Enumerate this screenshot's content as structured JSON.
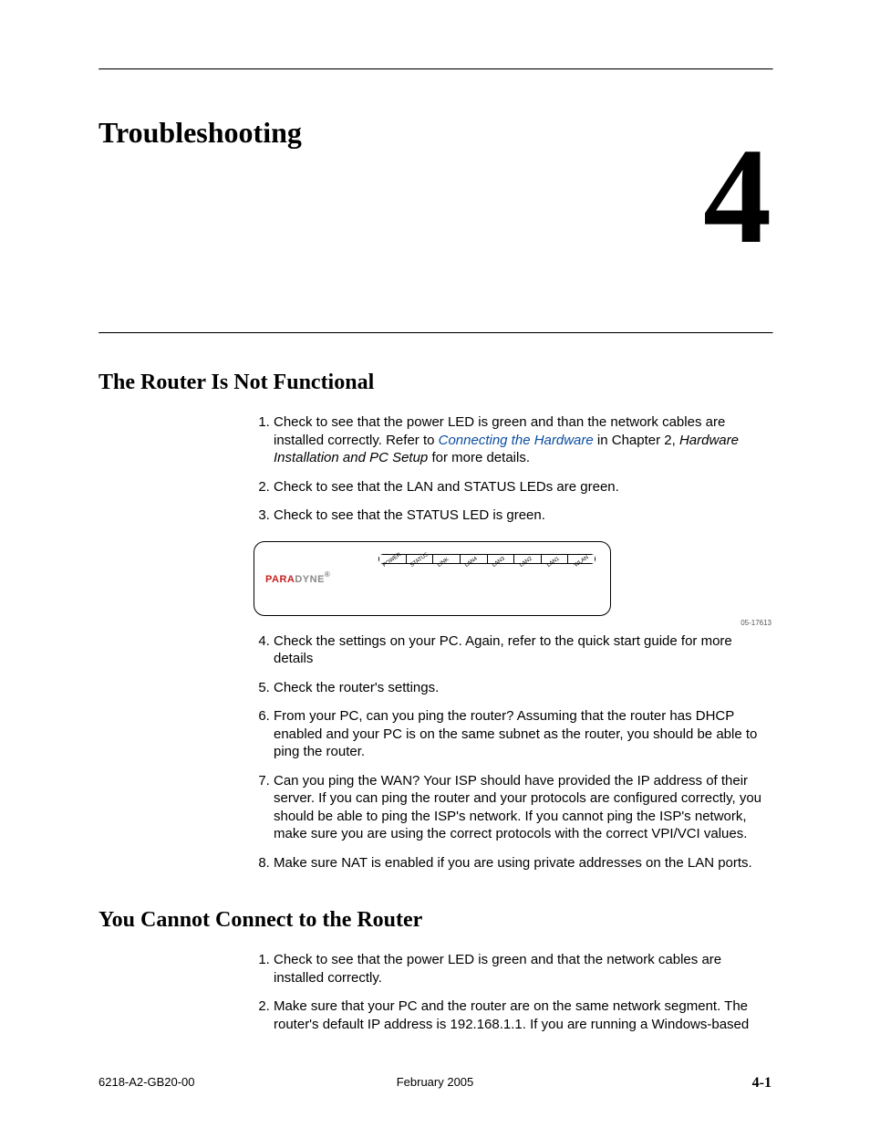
{
  "chapter": {
    "title": "Troubleshooting",
    "number": "4"
  },
  "section1": {
    "heading": "The Router Is Not Functional",
    "items": {
      "s1a": "Check to see that the power LED is green and than the network cables are installed correctly. Refer to ",
      "s1b_link": "Connecting the Hardware",
      "s1c": " in Chapter 2, ",
      "s1d_ital": "Hardware Installation and PC Setup",
      "s1e": " for more details.",
      "s2": "Check to see that the LAN and STATUS LEDs are green.",
      "s3": "Check to see that the STATUS LED is green.",
      "s4": "Check the settings on your PC. Again, refer to the quick start guide for more details",
      "s5": "Check the router's settings.",
      "s6": "From your PC, can you ping the router? Assuming that the router has DHCP enabled and your PC is on the same subnet as the router, you should be able to ping the router.",
      "s7": "Can you ping the WAN? Your ISP should have provided the IP address of their server. If you can ping the router and your protocols are configured correctly, you should be able to ping the ISP's network. If you cannot ping the ISP's network, make sure you are using the correct protocols with the correct VPI/VCI values.",
      "s8": "Make sure NAT is enabled if you are using private addresses on the LAN ports."
    }
  },
  "router_diagram": {
    "brand_red": "PARA",
    "brand_grey": "DYNE",
    "reg_mark": "®",
    "leds": [
      "POWER",
      "STATUS",
      "LINK",
      "LAN4",
      "LAN3",
      "LAN2",
      "LAN1",
      "WLAN"
    ],
    "figure_id": "05-17613"
  },
  "section2": {
    "heading": "You Cannot Connect to the Router",
    "items": {
      "s1": "Check to see that the power LED is green and that the network cables are installed correctly.",
      "s2": "Make sure that your PC and the router are on the same network segment. The router's default IP address is 192.168.1.1. If you are running a Windows-based"
    }
  },
  "footer": {
    "left": "6218-A2-GB20-00",
    "center": "February 2005",
    "right": "4-1"
  }
}
